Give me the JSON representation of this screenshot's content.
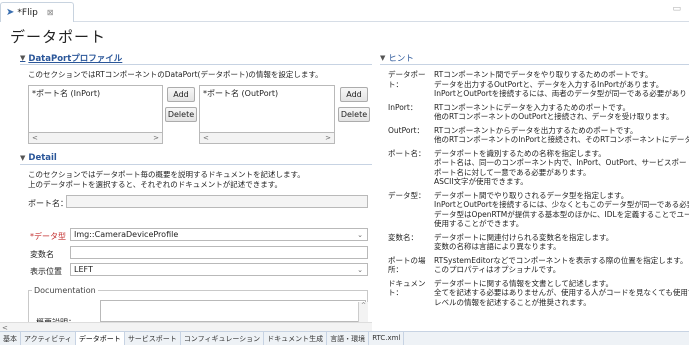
{
  "editor": {
    "tab_label": "*Flip",
    "tab_close": "⊠",
    "page_title": "データポート"
  },
  "dataport_section": {
    "title": "DataPortプロファイル",
    "description": "このセクションではRTコンポーネントのDataPort(データポート)の情報を設定します。",
    "inport_items": [
      "*ポート名 (InPort)"
    ],
    "outport_items": [
      "*ポート名 (OutPort)"
    ],
    "add_label": "Add",
    "delete_label": "Delete"
  },
  "detail_section": {
    "title": "Detail",
    "description_1": "このセクションではデータポート毎の概要を説明するドキュメントを記述します。",
    "description_2": "上のデータポートを選択すると、それぞれのドキュメントが記述できます。",
    "port_name_label": "ポート名：",
    "port_name_value": "",
    "data_type_label": "*データ型",
    "data_type_value": "Img::CameraDeviceProfile",
    "var_name_label": "変数名",
    "var_name_value": "",
    "display_pos_label": "表示位置",
    "display_pos_value": "LEFT",
    "documentation_title": "Documentation",
    "summary_label": "概要説明："
  },
  "hint_section": {
    "title": "ヒント",
    "rows": [
      {
        "key": "データポート：",
        "lines": [
          "RTコンポーネント間でデータをやり取りするためのポートです。",
          "データを出力するOutPortと、データを入力するInPortがあります。",
          "InPortとOutPortを接続するには、両者のデータ型が同一である必要があり"
        ]
      },
      {
        "key": "InPort：",
        "lines": [
          "RTコンポーネントにデータを入力するためのポートです。",
          "他のRTコンポーネントのOutPortと接続され、データを受け取ります。"
        ]
      },
      {
        "key": "OutPort：",
        "lines": [
          "RTコンポーネントからデータを出力するためのポートです。",
          "他のRTコンポーネントのInPortと接続され、そのRTコンポーネントにデータを送"
        ]
      },
      {
        "key": "ポート名：",
        "lines": [
          "データポートを識別するための名称を指定します。",
          "ポート名は、同一のコンポーネント内で、InPort、OutPort、サービスポートを",
          "ポート名に対して一意である必要があります。",
          "ASCII文字が使用できます。"
        ]
      },
      {
        "key": "データ型：",
        "lines": [
          "データポート間でやり取りされるデータ型を指定します。",
          "InPortとOutPortを接続するには、少なくともこのデータ型が同一である必要が",
          "データ型はOpenRTMが提供する基本型のほかに、IDLを定義することでユー",
          "使用することができます。"
        ]
      },
      {
        "key": "変数名：",
        "lines": [
          "データポートに関連付けられる変数名を指定します。",
          "変数の名称は言語により異なります。"
        ]
      },
      {
        "key": "ポートの場所：",
        "lines": [
          "RTSystemEditorなどでコンポーネントを表示する際の位置を指定します。",
          "このプロパティはオプショナルです。"
        ]
      },
      {
        "key": "ドキュメント：",
        "lines": [
          "データポートに関する情報を文書として記述します。",
          "全てを記述する必要はありませんが、使用する人がコードを見なくても使用でき",
          "レベルの情報を記述することが推奨されます。"
        ]
      }
    ]
  },
  "bottom_tabs": [
    "基本",
    "アクティビティ",
    "データポート",
    "サービスポート",
    "コンフィギュレーション",
    "ドキュメント生成",
    "言語・環境",
    "RTC.xml"
  ]
}
